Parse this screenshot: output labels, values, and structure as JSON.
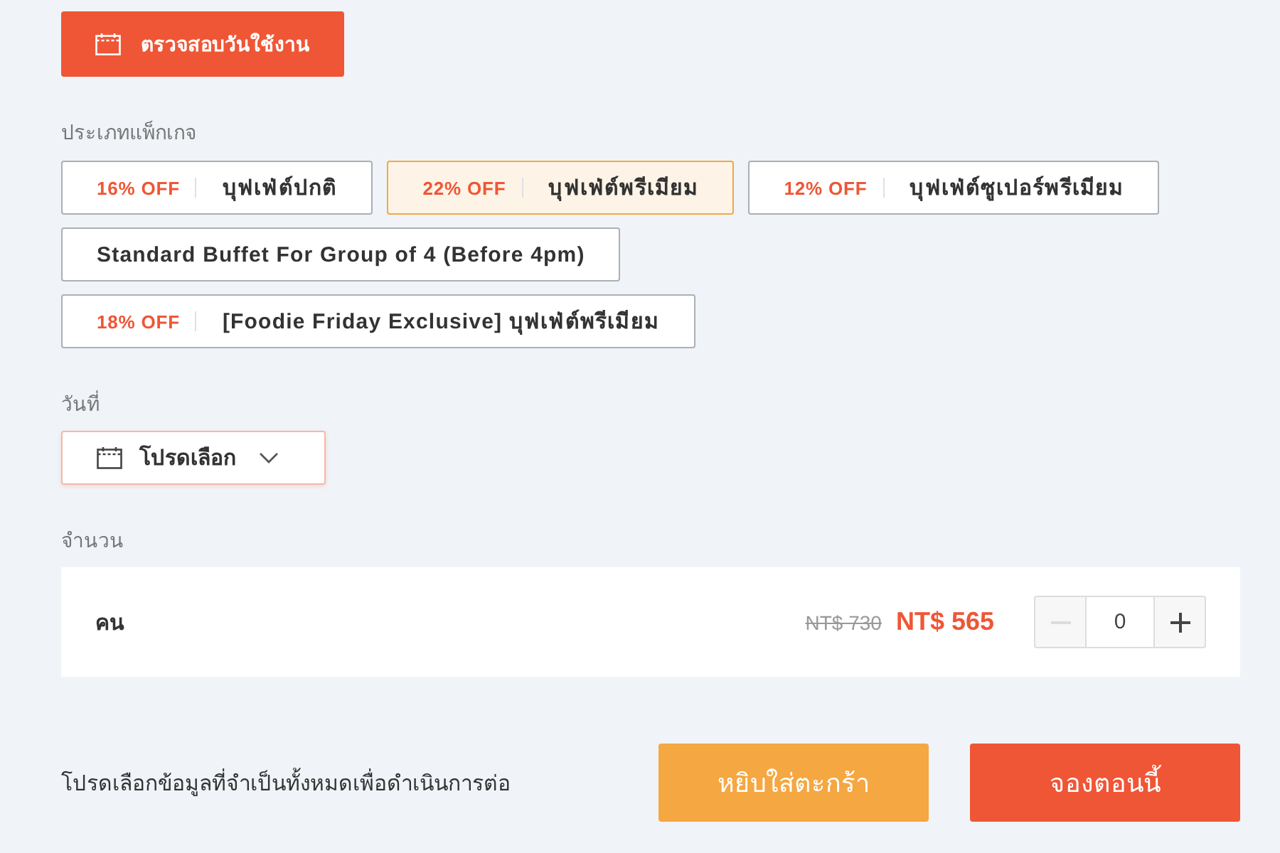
{
  "check_button": {
    "label": "ตรวจสอบวันใช้งาน"
  },
  "package_section": {
    "label": "ประเภทแพ็กเกจ",
    "options": [
      {
        "discount": "16% OFF",
        "name": "บุฟเฟ่ต์ปกติ",
        "selected": false
      },
      {
        "discount": "22% OFF",
        "name": "บุฟเฟ่ต์พรีเมียม",
        "selected": true
      },
      {
        "discount": "12% OFF",
        "name": "บุฟเฟ่ต์ซูเปอร์พรีเมียม",
        "selected": false
      },
      {
        "name": "Standard Buffet For Group of 4 (Before 4pm)",
        "selected": false
      },
      {
        "discount": "18% OFF",
        "name": "[Foodie Friday Exclusive] บุฟเฟ่ต์พรีเมียม",
        "selected": false
      }
    ]
  },
  "date_section": {
    "label": "วันที่",
    "placeholder": "โปรดเลือก"
  },
  "quantity_section": {
    "label": "จำนวน",
    "rows": [
      {
        "label": "คน",
        "original_price": "NT$ 730",
        "price": "NT$ 565",
        "value": "0",
        "minus_disabled": true
      }
    ]
  },
  "footer": {
    "message": "โปรดเลือกข้อมูลที่จำเป็นทั้งหมดเพื่อดำเนินการต่อ",
    "buttons": [
      {
        "label": "หยิบใส่ตะกร้า",
        "kind": "cart"
      },
      {
        "label": "จองตอนนี้",
        "kind": "book"
      }
    ]
  }
}
